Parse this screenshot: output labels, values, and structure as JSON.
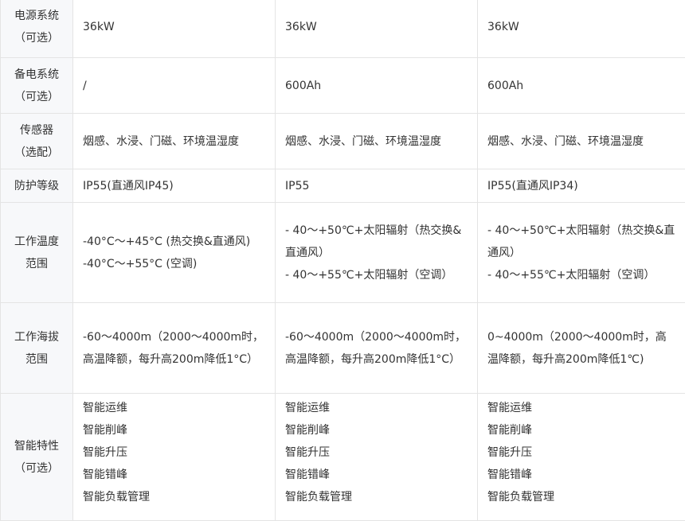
{
  "table": {
    "rows": [
      {
        "key": "power",
        "label_lines": [
          "电源系统",
          "（可选）"
        ],
        "cells": [
          [
            "36kW"
          ],
          [
            "36kW"
          ],
          [
            "36kW"
          ]
        ]
      },
      {
        "key": "backup",
        "label_lines": [
          "备电系统",
          "（可选）"
        ],
        "cells": [
          [
            "/"
          ],
          [
            "600Ah"
          ],
          [
            "600Ah"
          ]
        ]
      },
      {
        "key": "sensor",
        "label_lines": [
          "传感器",
          "（选配）"
        ],
        "cells": [
          [
            "烟感、水浸、门磁、环境温湿度"
          ],
          [
            "烟感、水浸、门磁、环境温湿度"
          ],
          [
            "烟感、水浸、门磁、环境温湿度"
          ]
        ]
      },
      {
        "key": "protect",
        "label_lines": [
          "防护等级"
        ],
        "cells": [
          [
            "IP55(直通风IP45)"
          ],
          [
            "IP55"
          ],
          [
            "IP55(直通风IP34)"
          ]
        ]
      },
      {
        "key": "temp",
        "label_lines": [
          "工作温度",
          "范围"
        ],
        "cells": [
          [
            "-40°C～+45°C (热交换&直通风)",
            "-40°C～+55°C (空调)"
          ],
          [
            "- 40～+50℃+太阳辐射（热交换&直通风）",
            "- 40～+55℃+太阳辐射（空调）"
          ],
          [
            "- 40～+50℃+太阳辐射（热交换&直通风）",
            "- 40～+55℃+太阳辐射（空调）"
          ]
        ]
      },
      {
        "key": "altitude",
        "label_lines": [
          "工作海拔",
          "范围"
        ],
        "cells": [
          [
            "-60～4000m（2000～4000m时，高温降额，每升高200m降低1°C）"
          ],
          [
            "-60～4000m（2000～4000m时，高温降额，每升高200m降低1°C）"
          ],
          [
            "0~4000m（2000～4000m时，高温降额，每升高200m降低1℃)"
          ]
        ]
      },
      {
        "key": "smart",
        "label_lines": [
          "智能特性",
          "（可选）"
        ],
        "cells": [
          [
            "智能运维",
            "智能削峰",
            "智能升压",
            "智能错峰",
            "智能负载管理"
          ],
          [
            "智能运维",
            "智能削峰",
            "智能升压",
            "智能错峰",
            "智能负载管理"
          ],
          [
            "智能运维",
            "智能削峰",
            "智能升压",
            "智能错峰",
            "智能负载管理"
          ]
        ]
      }
    ]
  }
}
